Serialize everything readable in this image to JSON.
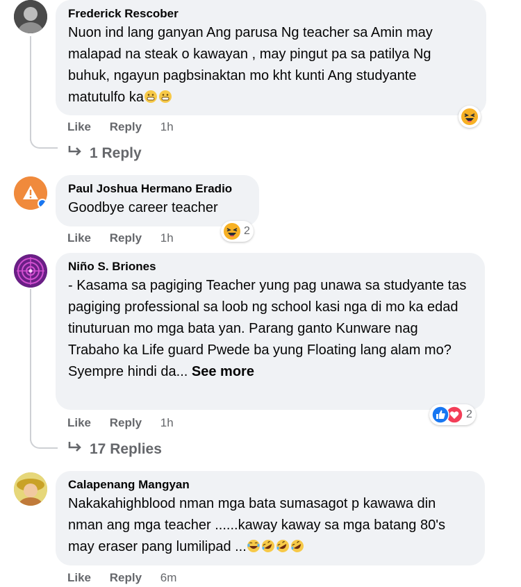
{
  "comments": [
    {
      "author": "Frederick Rescober",
      "text": "Nuon ind lang ganyan Ang parusa Ng teacher sa Amin may malapad na steak o kawayan , may pingut pa sa patilya Ng buhuk, ngayun pagbsinaktan mo kht kunti Ang studyante matutulfo ka",
      "emoji_suffix": [
        "grin-emoji",
        "grin-emoji"
      ],
      "like": "Like",
      "reply": "Reply",
      "time": "1h",
      "reactions": [
        "haha"
      ],
      "reaction_count": "",
      "replies_label": "1 Reply"
    },
    {
      "author": "Paul Joshua Hermano Eradio",
      "text": "Goodbye career teacher",
      "like": "Like",
      "reply": "Reply",
      "time": "1h",
      "reactions": [
        "haha"
      ],
      "reaction_count": "2"
    },
    {
      "author": "Niño S. Briones",
      "text": "- Kasama sa pagiging Teacher yung pag unawa sa studyante tas pagiging professional sa loob ng school kasi nga di mo ka edad tinuturuan mo mga bata yan. Parang ganto Kunware nag Trabaho ka Life guard Pwede ba yung Floating lang alam mo? Syempre hindi da...",
      "see_more": "See more",
      "like": "Like",
      "reply": "Reply",
      "time": "1h",
      "reactions": [
        "like",
        "love"
      ],
      "reaction_count": "2",
      "replies_label": "17 Replies"
    },
    {
      "author": "Calapenang Mangyan",
      "text": "Nakakahighblood nman mga bata sumasagot p kawawa din nman ang mga teacher ......kaway kaway sa mga batang 80's may eraser pang lumilipad ...",
      "emoji_suffix": [
        "laugh-cry-emoji",
        "rofl-emoji",
        "rofl-emoji",
        "rofl-emoji"
      ],
      "like": "Like",
      "reply": "Reply",
      "time": "6m"
    }
  ],
  "colors": {
    "bubble": "#f0f2f5",
    "meta": "#65676b",
    "like_blue": "#1877f2",
    "love_red": "#f33e58",
    "haha_yellow": "#f7b125"
  }
}
